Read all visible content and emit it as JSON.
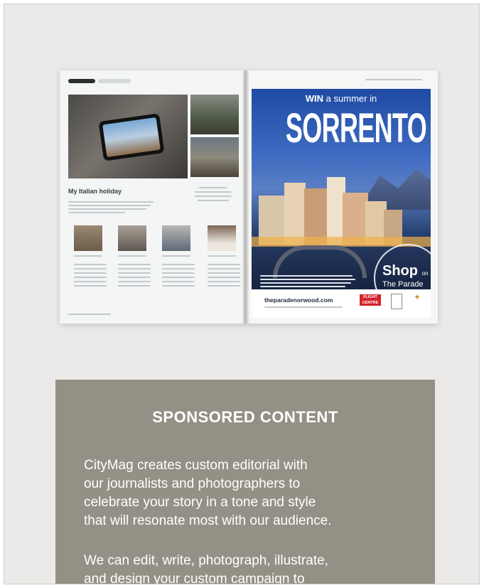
{
  "magazine": {
    "left_page": {
      "headline": "My Italian holiday"
    },
    "cover": {
      "win_bold": "WIN",
      "win_rest": " a summer in",
      "title": "SORRENTO",
      "shop_text": "Shop",
      "shop_on": "on",
      "shop_parade": "The Parade",
      "footer_url": "theparadenorwood.com",
      "sponsor_logo": "FLIGHT CENTRE"
    }
  },
  "panel": {
    "title": "SPONSORED CONTENT",
    "paragraph_1_lines": [
      "CityMag creates custom editorial with",
      "our journalists and photographers to",
      "celebrate your story in a tone and style",
      "that will resonate most with our audience."
    ],
    "paragraph_2_lines": [
      "We can edit, write, photograph, illustrate,",
      "and design your custom campaign to"
    ]
  },
  "colors": {
    "background": "#ebeae8",
    "panel": "#959086",
    "panel_text": "#ffffff",
    "cover_blue": "#2e5bb5",
    "flight_centre_red": "#d2232a"
  }
}
